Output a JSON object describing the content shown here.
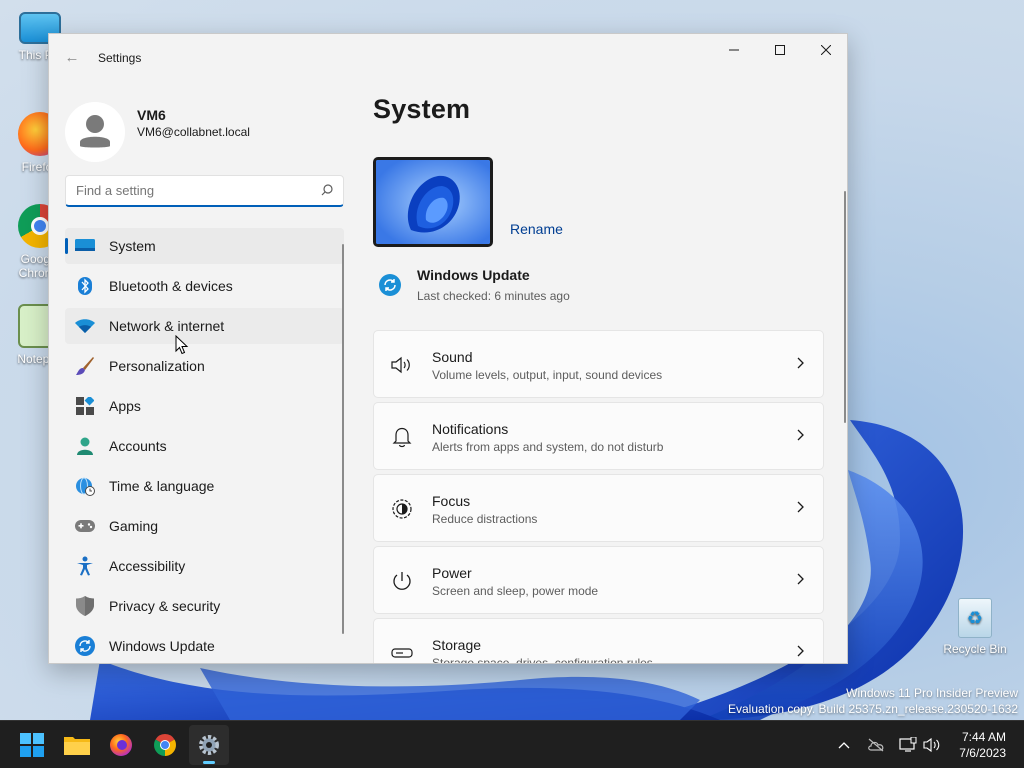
{
  "desktop": {
    "icons": [
      {
        "label": "This PC"
      },
      {
        "label": "Firefox"
      },
      {
        "label": "Google Chrome"
      },
      {
        "label": "Notepad"
      },
      {
        "label": "Recycle Bin"
      }
    ],
    "watermark": {
      "line1": "Windows 11 Pro Insider Preview",
      "line2": "Evaluation copy. Build 25375.zn_release.230520-1632"
    }
  },
  "window": {
    "title": "Settings",
    "controls": {
      "minimize": "minimize-icon",
      "maximize": "maximize-icon",
      "close": "close-icon"
    },
    "profile": {
      "name": "VM6",
      "email": "VM6@collabnet.local"
    },
    "search": {
      "placeholder": "Find a setting",
      "value": ""
    },
    "nav": [
      {
        "label": "System",
        "icon": "monitor-icon",
        "selected": true
      },
      {
        "label": "Bluetooth & devices",
        "icon": "bluetooth-icon"
      },
      {
        "label": "Network & internet",
        "icon": "wifi-icon",
        "hover": true
      },
      {
        "label": "Personalization",
        "icon": "brush-icon"
      },
      {
        "label": "Apps",
        "icon": "apps-icon"
      },
      {
        "label": "Accounts",
        "icon": "person-icon"
      },
      {
        "label": "Time & language",
        "icon": "globe-clock-icon"
      },
      {
        "label": "Gaming",
        "icon": "gamepad-icon"
      },
      {
        "label": "Accessibility",
        "icon": "accessibility-icon"
      },
      {
        "label": "Privacy & security",
        "icon": "shield-icon"
      },
      {
        "label": "Windows Update",
        "icon": "update-icon"
      }
    ],
    "content": {
      "title": "System",
      "rename_label": "Rename",
      "windows_update": {
        "title": "Windows Update",
        "subtitle": "Last checked: 6 minutes ago"
      },
      "cards": [
        {
          "title": "Sound",
          "subtitle": "Volume levels, output, input, sound devices",
          "icon": "speaker-icon"
        },
        {
          "title": "Notifications",
          "subtitle": "Alerts from apps and system, do not disturb",
          "icon": "bell-icon"
        },
        {
          "title": "Focus",
          "subtitle": "Reduce distractions",
          "icon": "focus-icon"
        },
        {
          "title": "Power",
          "subtitle": "Screen and sleep, power mode",
          "icon": "power-icon"
        },
        {
          "title": "Storage",
          "subtitle": "Storage space, drives, configuration rules",
          "icon": "storage-icon"
        }
      ]
    }
  },
  "taskbar": {
    "apps": [
      "start-icon",
      "file-explorer-icon",
      "firefox-icon",
      "chrome-icon",
      "settings-icon"
    ],
    "tray": [
      "chevron-up-icon",
      "onedrive-icon",
      "network-icon",
      "volume-icon"
    ],
    "time": "7:44 AM",
    "date": "7/6/2023"
  },
  "colors": {
    "accent": "#005fb8",
    "link": "#003e92",
    "taskbar": "#1f1f1f"
  }
}
